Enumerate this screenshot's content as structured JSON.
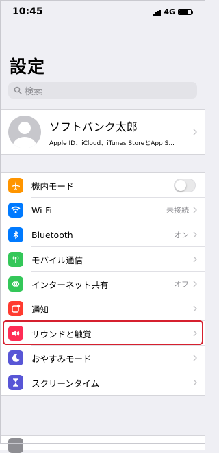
{
  "status": {
    "time": "10:45",
    "network": "4G",
    "battery_level": 0.8
  },
  "title": "設定",
  "search": {
    "placeholder": "検索"
  },
  "profile": {
    "name": "ソフトバンク太郎",
    "subtitle": "Apple ID、iCloud、iTunes StoreとApp S..."
  },
  "connectivity": [
    {
      "label": "機内モード",
      "icon": "airplane-icon",
      "color": "#ff9500",
      "toggle_on": false
    },
    {
      "label": "Wi-Fi",
      "icon": "wifi-icon",
      "color": "#007aff",
      "value": "未接続"
    },
    {
      "label": "Bluetooth",
      "icon": "bluetooth-icon",
      "color": "#007aff",
      "value": "オン"
    },
    {
      "label": "モバイル通信",
      "icon": "antenna-icon",
      "color": "#34c759",
      "value": ""
    },
    {
      "label": "インターネット共有",
      "icon": "hotspot-icon",
      "color": "#34c759",
      "value": "オフ"
    }
  ],
  "general": [
    {
      "label": "通知",
      "icon": "notifications-icon",
      "color": "#ff3b30"
    },
    {
      "label": "サウンドと触覚",
      "icon": "speaker-icon",
      "color": "#ff2d55"
    },
    {
      "label": "おやすみモード",
      "icon": "moon-icon",
      "color": "#5856d6"
    },
    {
      "label": "スクリーンタイム",
      "icon": "hourglass-icon",
      "color": "#5856d6"
    }
  ],
  "highlight_color": "#d6202f"
}
